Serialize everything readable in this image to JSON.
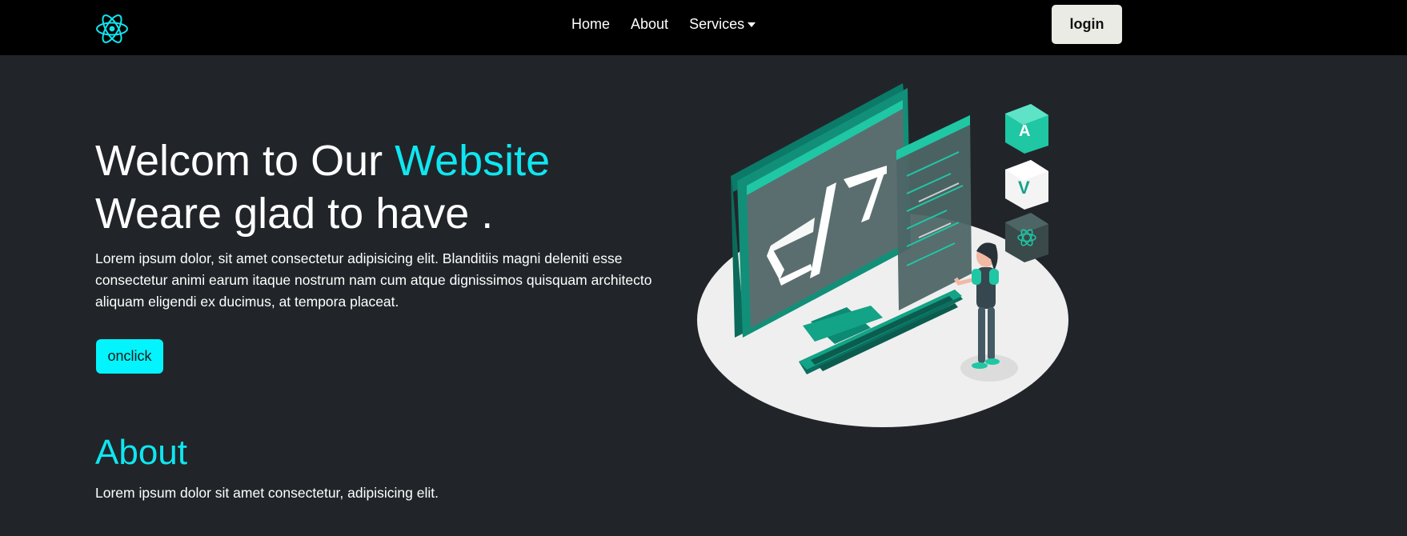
{
  "navbar": {
    "logo_icon": "react-atom-icon",
    "links": [
      {
        "label": "Home"
      },
      {
        "label": "About"
      },
      {
        "label": "Services"
      }
    ],
    "login_label": "login"
  },
  "hero": {
    "title_prefix": "Welcom to Our ",
    "title_accent": "Website",
    "title_line2": "Weare glad to have .",
    "body": "Lorem ipsum dolor, sit amet consectetur adipisicing elit. Blanditiis magni deleniti esse consectetur animi earum itaque nostrum nam cum atque dignissimos quisquam architecto aliquam eligendi ex ducimus, at tempora placeat.",
    "button_label": "onclick",
    "illustration_icon": "developer-computer-illustration"
  },
  "about": {
    "heading": "About",
    "text": "Lorem ipsum dolor sit amet consectetur, adipisicing elit."
  },
  "colors": {
    "navbar_bg": "#000000",
    "page_bg": "#212529",
    "accent": "#0fe6f0",
    "button_bg": "#03f4fc",
    "login_bg": "#e9ebe4",
    "teal": "#14a08a"
  }
}
